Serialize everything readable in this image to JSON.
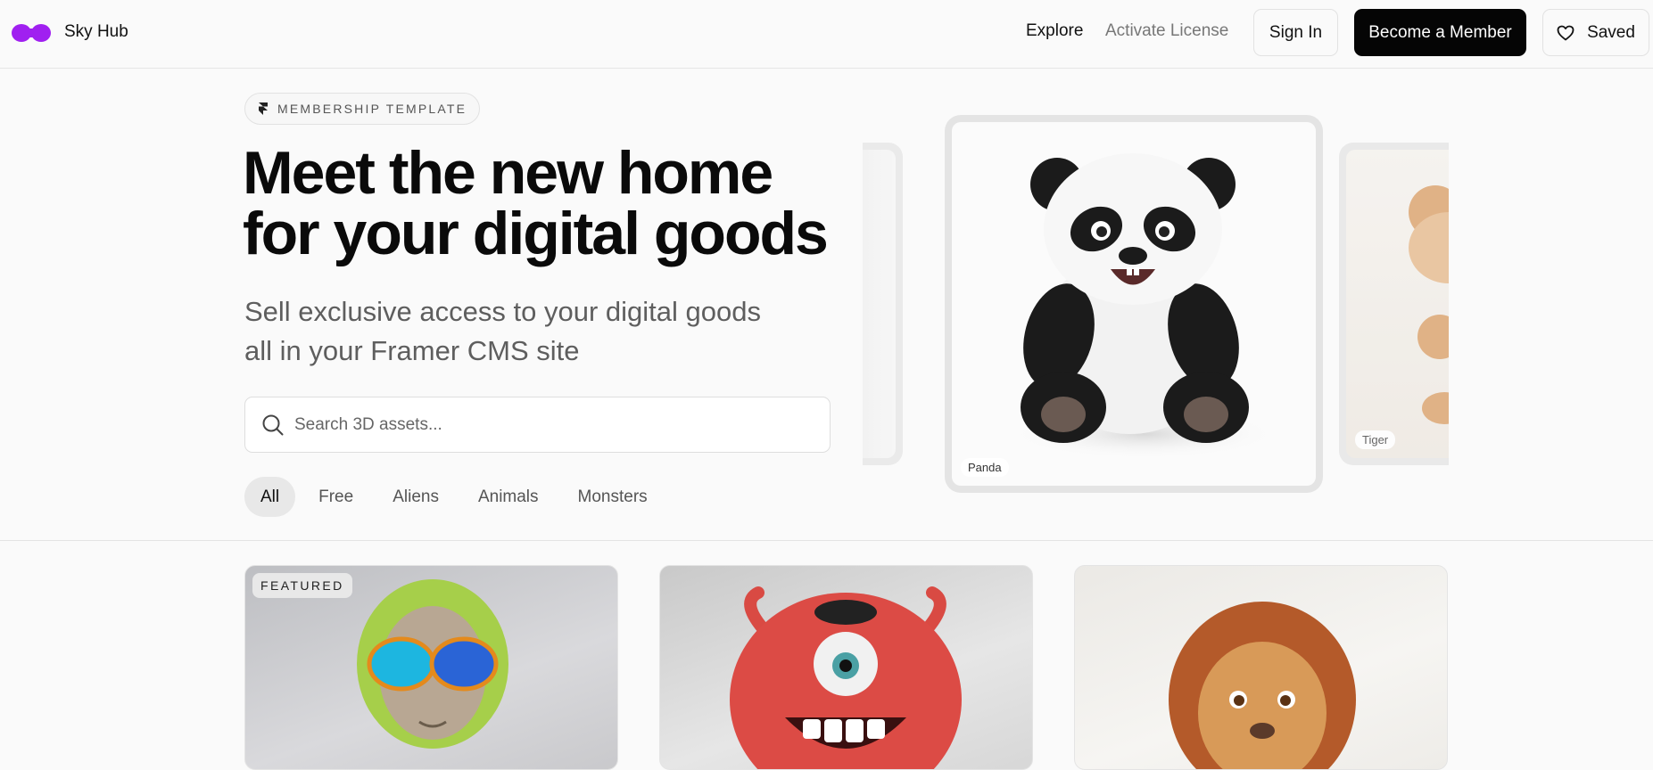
{
  "header": {
    "brand": "Sky Hub",
    "brand_color": "#a020f0",
    "nav": {
      "explore": "Explore",
      "activate_license": "Activate License"
    },
    "buttons": {
      "sign_in": "Sign In",
      "become_member": "Become a Member",
      "saved": "Saved"
    }
  },
  "hero": {
    "badge": "MEMBERSHIP TEMPLATE",
    "title_line1": "Meet the new home",
    "title_line2": "for your digital goods",
    "subtitle_line1": "Sell exclusive access to your digital goods",
    "subtitle_line2": "all in your Framer CMS site",
    "search_placeholder": "Search 3D assets...",
    "filters": [
      "All",
      "Free",
      "Aliens",
      "Animals",
      "Monsters"
    ],
    "active_filter": "All"
  },
  "carousel": {
    "center_label": "Panda",
    "right_label": "Tiger"
  },
  "products": {
    "featured_badge": "FEATURED",
    "icons": [
      "alien-image",
      "red-monster-image",
      "lion-image"
    ]
  }
}
